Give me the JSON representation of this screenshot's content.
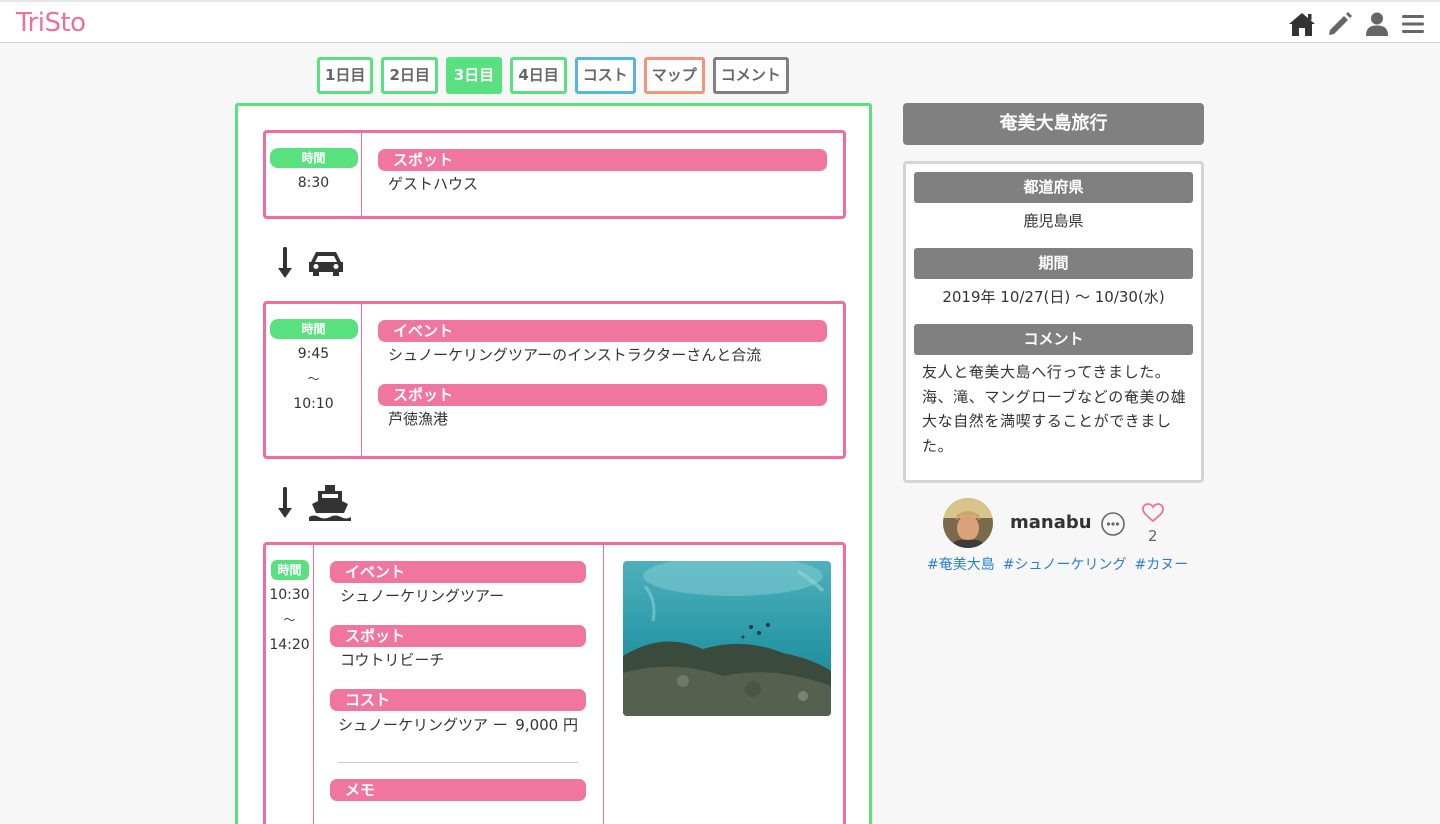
{
  "brand": "TriSto",
  "tabs": [
    "1日目",
    "2日目",
    "3日目",
    "4日目",
    "コスト",
    "マップ",
    "コメント"
  ],
  "active_tab": "3日目",
  "timeline": {
    "items": [
      {
        "time_label": "時間",
        "times": [
          "8:30"
        ],
        "entries": [
          {
            "label": "スポット",
            "value": "ゲストハウス"
          }
        ]
      },
      {
        "time_label": "時間",
        "times": [
          "9:45",
          "〜",
          "10:10"
        ],
        "entries": [
          {
            "label": "イベント",
            "value": "シュノーケリングツアーのインストラクターさんと合流"
          },
          {
            "label": "スポット",
            "value": "芦徳漁港"
          }
        ]
      },
      {
        "time_label": "時間",
        "times": [
          "10:30",
          "〜",
          "14:20"
        ],
        "entries": [
          {
            "label": "イベント",
            "value": "シュノーケリングツアー"
          },
          {
            "label": "スポット",
            "value": "コウトリビーチ"
          },
          {
            "label": "コスト",
            "value": "シュノーケリングツア ー",
            "amount": "9,000 円"
          },
          {
            "label": "メモ",
            "value": ""
          }
        ]
      }
    ],
    "transports": [
      "car-icon",
      "ship-icon"
    ]
  },
  "sidebar": {
    "title": "奄美大島旅行",
    "prefecture_label": "都道府県",
    "prefecture": "鹿児島県",
    "period_label": "期間",
    "period": "2019年 10/27(日) 〜 10/30(水)",
    "comment_label": "コメント",
    "comment": "友人と奄美大島へ行ってきました。海、滝、マングローブなどの奄美の雄大な自然を満喫することができました。",
    "user": "manabu",
    "likes": "2",
    "tags": [
      "#奄美大島",
      "#シュノーケリング",
      "#カヌー"
    ]
  },
  "colors": {
    "brand": "#f06e9c",
    "green": "#59e07f",
    "pink": "#f076a0",
    "gray": "#808080",
    "blue": "#2a7fd6"
  }
}
